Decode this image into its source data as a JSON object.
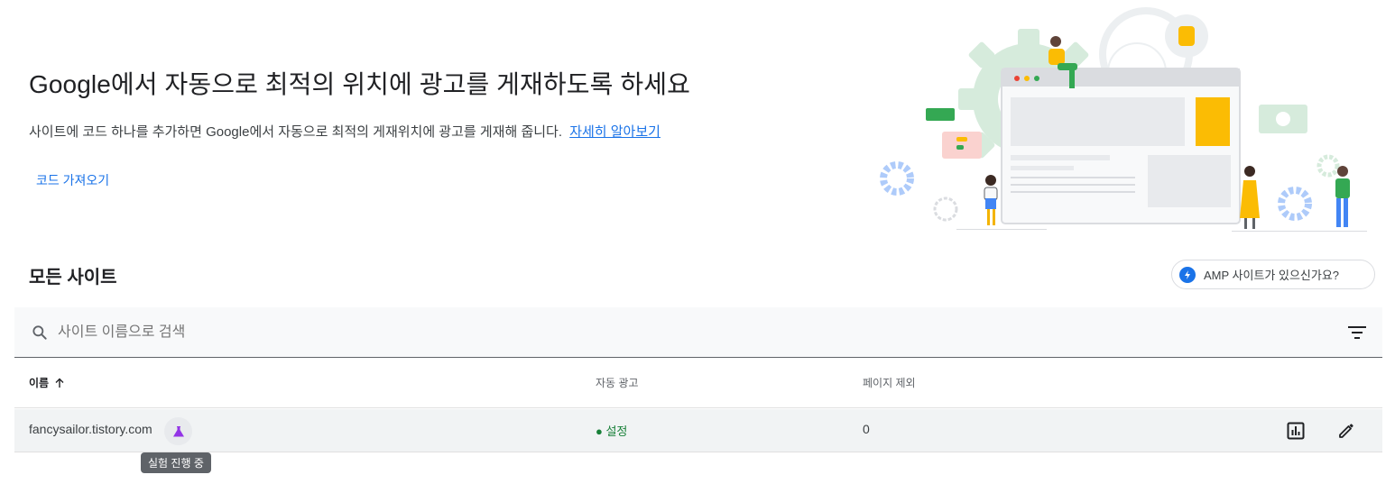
{
  "hero": {
    "title": "Google에서 자동으로 최적의 위치에 광고를 게재하도록 하세요",
    "description": "사이트에 코드 하나를 추가하면 Google에서 자동으로 최적의 게재위치에 광고를 게재해 줍니다.",
    "learn_more": "자세히 알아보기",
    "get_code": "코드 가져오기"
  },
  "sites": {
    "section_title": "모든 사이트",
    "amp_chip": "AMP 사이트가 있으신가요?",
    "search_placeholder": "사이트 이름으로 검색",
    "columns": {
      "name": "이름",
      "auto_ads": "자동 광고",
      "page_exclusions": "페이지 제외"
    },
    "rows": [
      {
        "site": "fancysailor.tistory.com",
        "status": "● 설정",
        "exclusions": "0",
        "tooltip": "실험 진행 중"
      }
    ]
  },
  "icons": {
    "search": "search-icon",
    "filter": "filter-icon",
    "amp": "bolt-icon",
    "sort": "arrow-up-icon",
    "experiment": "flask-icon",
    "report": "bar-chart-icon",
    "edit": "pencil-icon"
  },
  "colors": {
    "link": "#1a73e8",
    "status_on": "#188038",
    "experiment": "#9334e6",
    "row_bg": "#f1f3f4",
    "search_bg": "#f8f9fa"
  }
}
